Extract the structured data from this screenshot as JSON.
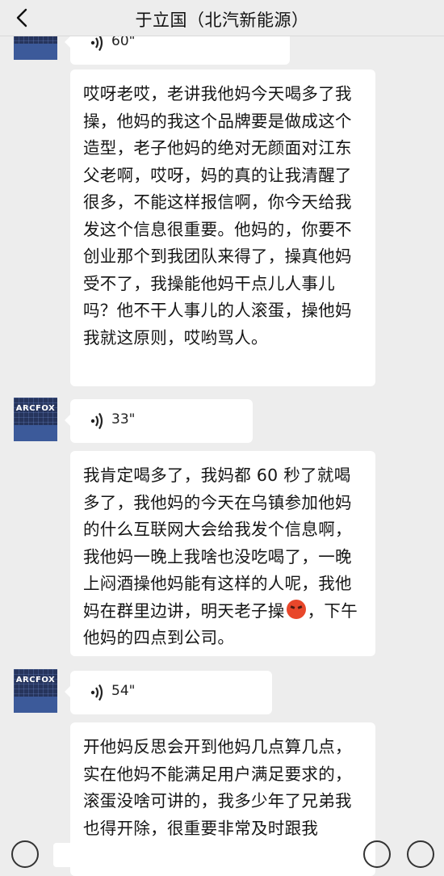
{
  "header": {
    "title": "于立国（北汽新能源）"
  },
  "avatar_label": "ARCFOX",
  "messages": {
    "voice0": {
      "duration": "60\""
    },
    "text1": "哎呀老哎，老讲我他妈今天喝多了我操，他妈的我这个品牌要是做成这个造型，老子他妈的绝对无颜面对江东父老啊，哎呀，妈的真的让我清醒了很多，不能这样报信啊，你今天给我发这个信息很重要。他妈的，你要不创业那个到我团队来得了，操真他妈受不了，我操能他妈干点儿人事儿吗？他不干人事儿的人滚蛋，操他妈我就这原则，哎哟骂人。",
    "voice1": {
      "duration": "33\""
    },
    "text2_before": "我肯定喝多了，我妈都 60 秒了就喝多了，我他妈的今天在乌镇参加他妈的什么互联网大会给我发个信息啊，我他妈一晚上我啥也没吃喝了，一晚上闷酒操他妈能有这样的人呢，我他妈在群里边讲，明天老子操",
    "text2_emoji": "angry-face-emoji",
    "text2_after": "，下午他妈的四点到公司。",
    "voice2": {
      "duration": "54\""
    },
    "text3": "开他妈反思会开到他妈几点算几点，实在他妈不能满足用户满足要求的，滚蛋没啥可讲的，我多少年了兄弟我也得开除，很重要非常及时跟我"
  },
  "colors": {
    "background": "#ededed",
    "bubble": "#ffffff",
    "avatar": "#26345c"
  }
}
